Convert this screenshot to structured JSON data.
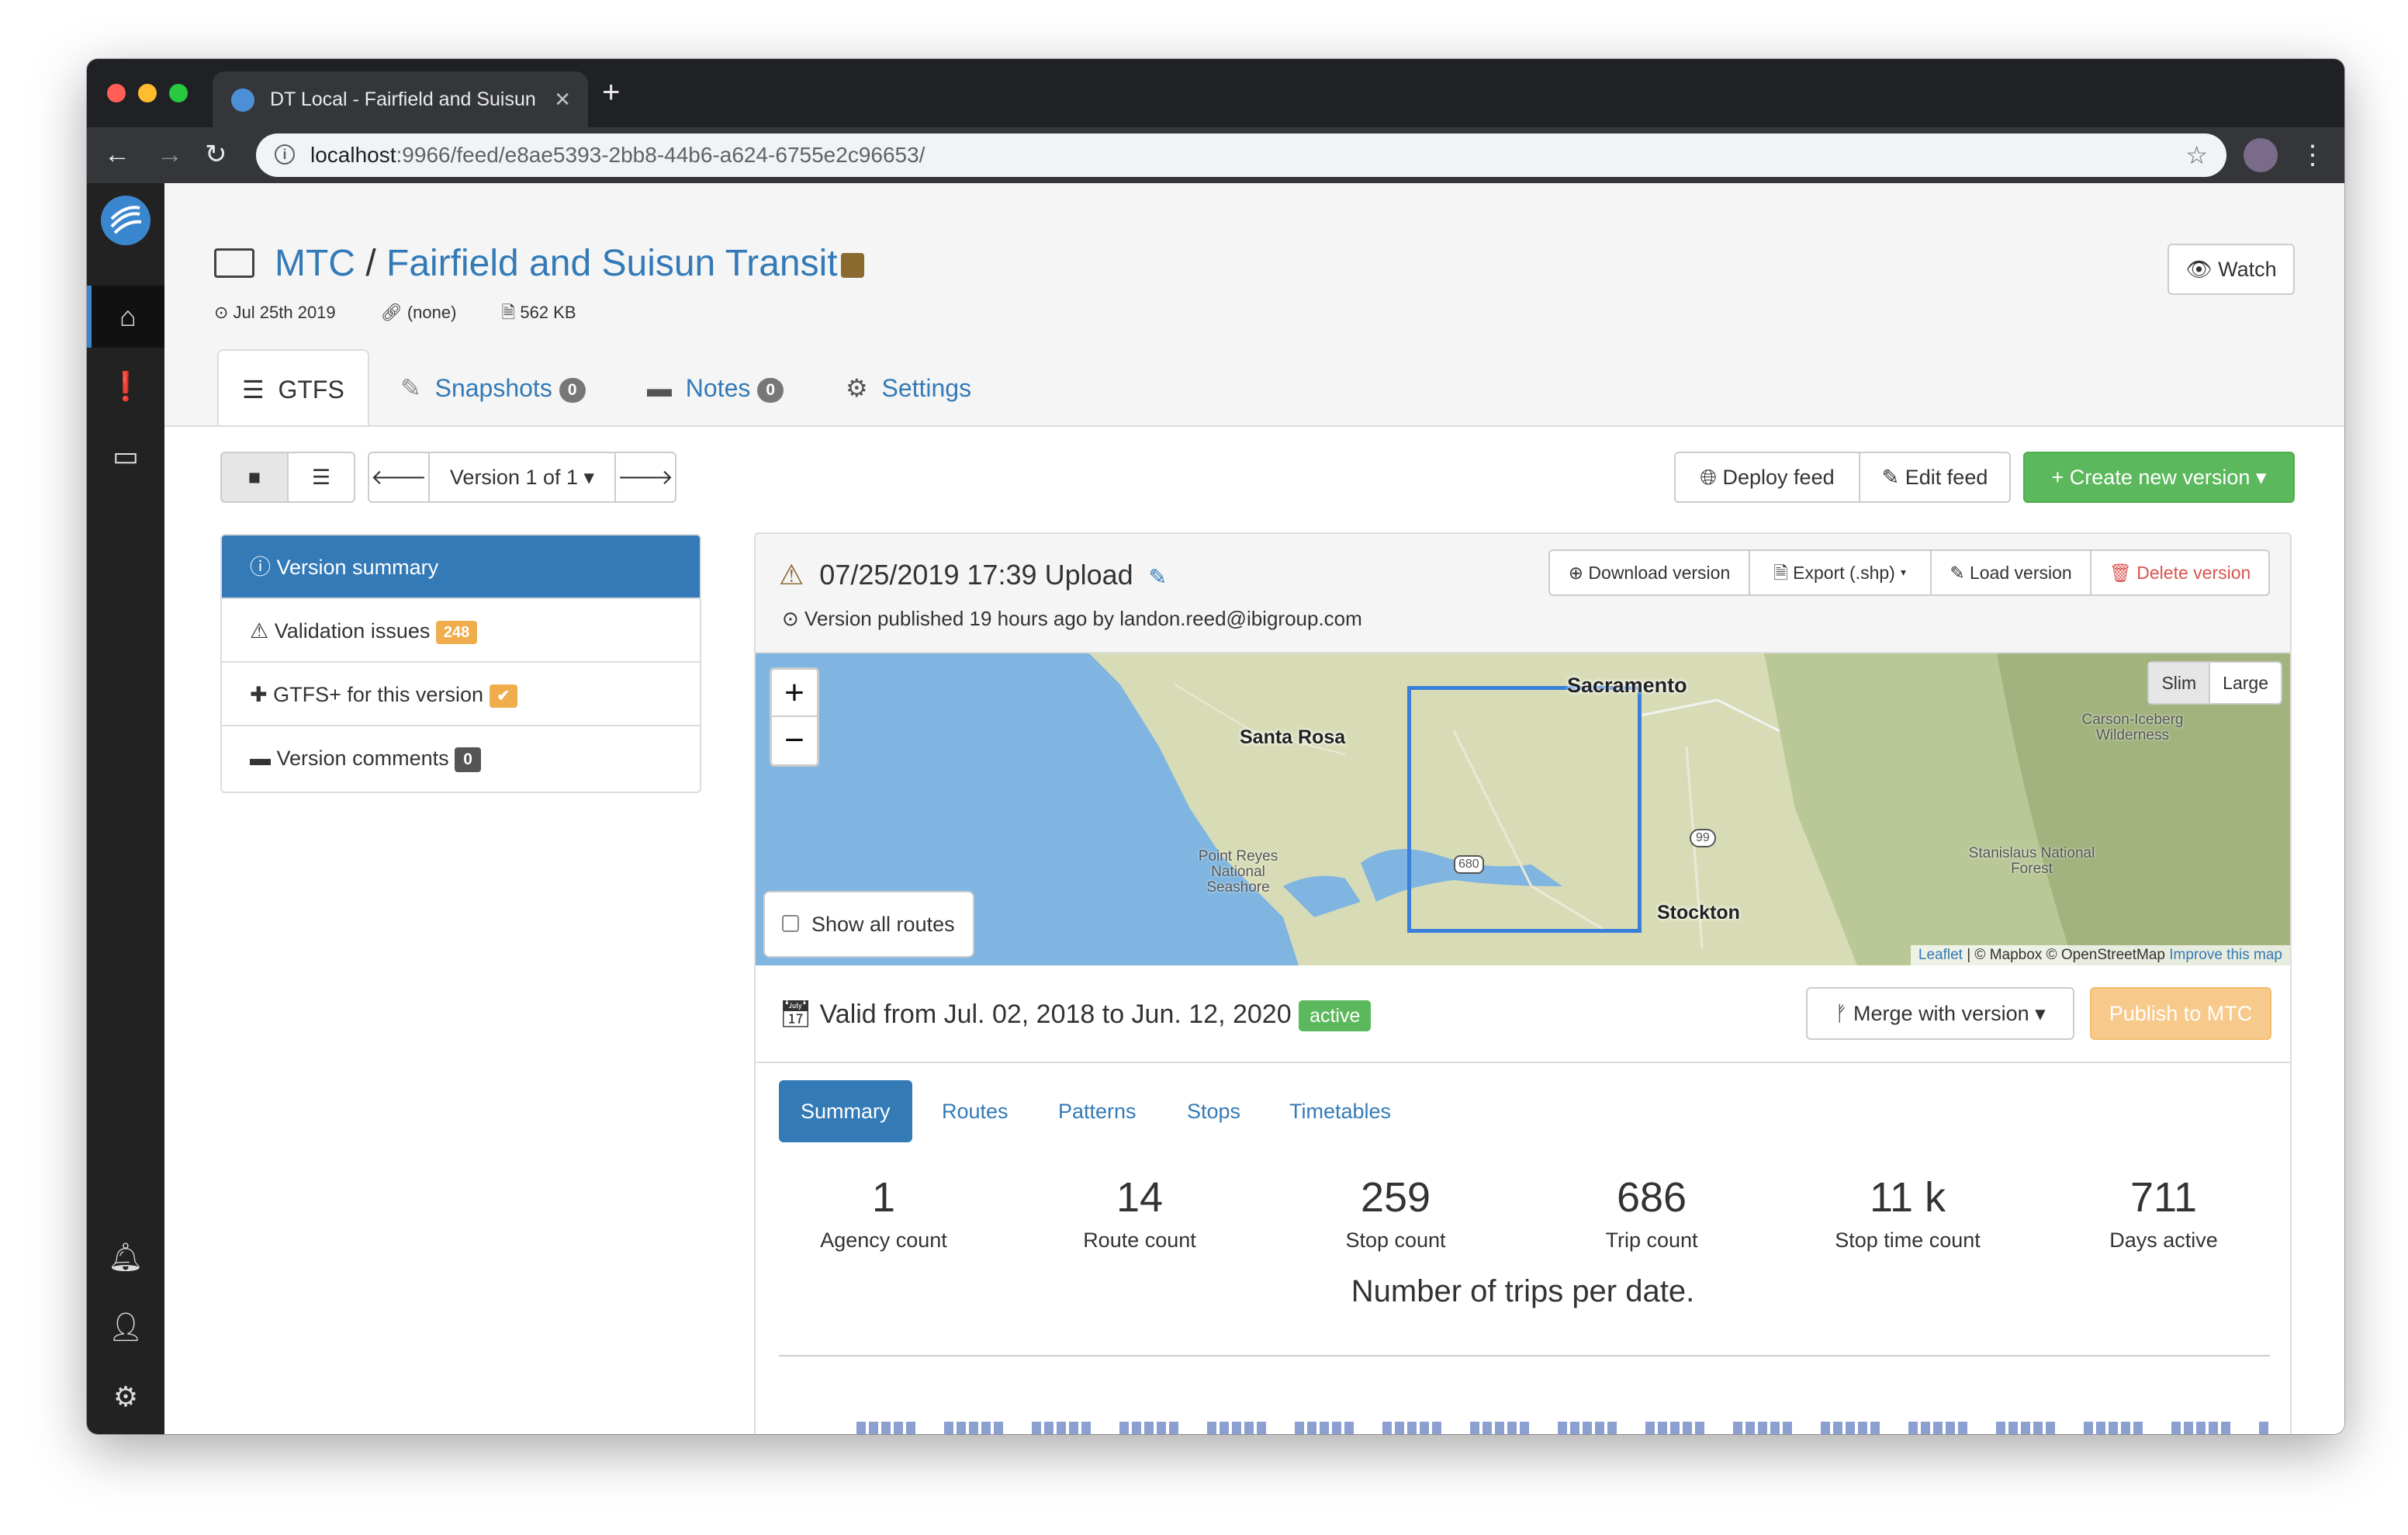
{
  "browser": {
    "tab_title": "DT Local - Fairfield and Suisun",
    "url_host": "localhost",
    "url_path": ":9966/feed/e8ae5393-2bb8-44b6-a624-6755e2c96653/"
  },
  "header": {
    "project": "MTC",
    "separator": "/",
    "feed_name": "Fairfield and Suisun Transit",
    "date": "Jul 25th 2019",
    "url_none": "(none)",
    "size": "562 KB",
    "watch_label": "Watch"
  },
  "tabs": [
    {
      "label": "GTFS",
      "badge": ""
    },
    {
      "label": "Snapshots",
      "badge": "0"
    },
    {
      "label": "Notes",
      "badge": "0"
    },
    {
      "label": "Settings",
      "badge": ""
    }
  ],
  "version_nav": {
    "label": "Version 1 of 1"
  },
  "actions": {
    "deploy": "Deploy feed",
    "edit": "Edit feed",
    "create": "Create new version"
  },
  "side_list": [
    {
      "label": "Version summary"
    },
    {
      "label": "Validation issues",
      "badge": "248"
    },
    {
      "label": "GTFS+ for this version",
      "badge": "✔"
    },
    {
      "label": "Version comments",
      "badge": "0"
    }
  ],
  "version": {
    "title": "07/25/2019 17:39 Upload",
    "published_prefix": "Version published 19 hours ago by",
    "published_by": "landon.reed@ibigroup.com",
    "download": "Download version",
    "export": "Export (.shp)",
    "load": "Load version",
    "delete": "Delete version"
  },
  "map": {
    "zoom_in": "+",
    "zoom_out": "−",
    "slim": "Slim",
    "large": "Large",
    "show_all_routes": "Show all routes",
    "labels": {
      "sacramento": "Sacramento",
      "santa_rosa": "Santa Rosa",
      "stockton": "Stockton",
      "point_reyes": "Point Reyes National Seashore",
      "carson": "Carson-Iceberg Wilderness",
      "stanislaus": "Stanislaus National Forest",
      "hwy680": "680",
      "hwy99": "99"
    },
    "attribution": {
      "leaflet": "Leaflet",
      "sep": " | © Mapbox © OpenStreetMap ",
      "improve": "Improve this map"
    }
  },
  "validity": {
    "text": "Valid from Jul. 02, 2018 to Jun. 12, 2020",
    "status": "active",
    "merge": "Merge with version",
    "publish": "Publish to MTC"
  },
  "subtabs": [
    "Summary",
    "Routes",
    "Patterns",
    "Stops",
    "Timetables"
  ],
  "stats": [
    {
      "value": "1",
      "label": "Agency count"
    },
    {
      "value": "14",
      "label": "Route count"
    },
    {
      "value": "259",
      "label": "Stop count"
    },
    {
      "value": "686",
      "label": "Trip count"
    },
    {
      "value": "11 k",
      "label": "Stop time count"
    },
    {
      "value": "711",
      "label": "Days active"
    }
  ],
  "chart_title": "Number of trips per date.",
  "colors": {
    "primary": "#337ab7",
    "success": "#5cb85c",
    "warning": "#f0ad4e",
    "danger": "#d9534f",
    "bar": "#8c9fd1"
  }
}
